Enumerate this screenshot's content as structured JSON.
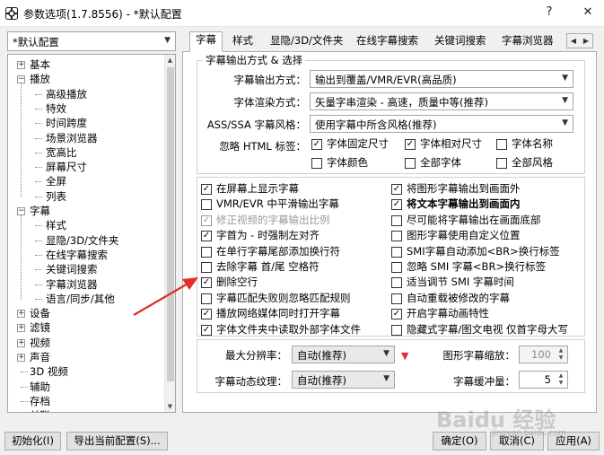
{
  "window": {
    "title": "参数选项(1.7.8556) - *默认配置",
    "buttons": [
      "?",
      "✕"
    ]
  },
  "profile": {
    "value": "*默认配置"
  },
  "tree": [
    {
      "label": "基本",
      "expander": "+",
      "level": 0
    },
    {
      "label": "播放",
      "expander": "−",
      "level": 0
    },
    {
      "label": "高级播放",
      "level": 1
    },
    {
      "label": "特效",
      "level": 1
    },
    {
      "label": "时间跨度",
      "level": 1
    },
    {
      "label": "场景浏览器",
      "level": 1
    },
    {
      "label": "宽高比",
      "level": 1
    },
    {
      "label": "屏幕尺寸",
      "level": 1
    },
    {
      "label": "全屏",
      "level": 1
    },
    {
      "label": "列表",
      "level": 1
    },
    {
      "label": "字幕",
      "expander": "−",
      "level": 0
    },
    {
      "label": "样式",
      "level": 1
    },
    {
      "label": "显隐/3D/文件夹",
      "level": 1
    },
    {
      "label": "在线字幕搜索",
      "level": 1
    },
    {
      "label": "关键词搜索",
      "level": 1
    },
    {
      "label": "字幕浏览器",
      "level": 1
    },
    {
      "label": "语言/同步/其他",
      "level": 1
    },
    {
      "label": "设备",
      "expander": "+",
      "level": 0
    },
    {
      "label": "滤镜",
      "expander": "+",
      "level": 0
    },
    {
      "label": "视频",
      "expander": "+",
      "level": 0
    },
    {
      "label": "声音",
      "expander": "+",
      "level": 0
    },
    {
      "label": "3D 视频",
      "level": 0
    },
    {
      "label": "辅助",
      "level": 0
    },
    {
      "label": "存档",
      "level": 0
    },
    {
      "label": "关联",
      "level": 0
    }
  ],
  "tabs": [
    "字幕",
    "样式",
    "显隐/3D/文件夹",
    "在线字幕搜索",
    "关键词搜索",
    "字幕浏览器"
  ],
  "tab_arrows": [
    "◀",
    "▶"
  ],
  "output_group": {
    "title": "字幕输出方式 & 选择",
    "rows": [
      {
        "label": "字幕输出方式：",
        "value": "输出到覆盖/VMR/EVR(高品质)"
      },
      {
        "label": "字体渲染方式：",
        "value": "矢量字串渲染 - 高速，质量中等(推荐)"
      },
      {
        "label": "ASS/SSA 字幕风格：",
        "value": "使用字幕中所含风格(推荐)"
      }
    ],
    "ignore_label": "忽略 HTML 标签：",
    "ignore_options": [
      {
        "label": "字体固定尺寸",
        "checked": true
      },
      {
        "label": "字体相对尺寸",
        "checked": true
      },
      {
        "label": "字体名称",
        "checked": false
      },
      {
        "label": "字体颜色",
        "checked": false
      },
      {
        "label": "全部字体",
        "checked": false
      },
      {
        "label": "全部风格",
        "checked": false
      }
    ]
  },
  "options_left": [
    {
      "label": "在屏幕上显示字幕",
      "checked": true
    },
    {
      "label": "VMR/EVR 中平滑输出字幕",
      "checked": false
    },
    {
      "label": "修正视频的字幕输出比例",
      "checked": true,
      "disabled": true
    },
    {
      "label": "字首为 - 时强制左对齐",
      "checked": true
    },
    {
      "label": "在单行字幕尾部添加换行符",
      "checked": false
    },
    {
      "label": "去除字幕 首/尾 空格符",
      "checked": false
    },
    {
      "label": "删除空行",
      "checked": true
    },
    {
      "label": "字幕匹配失败则忽略匹配规则",
      "checked": false
    },
    {
      "label": "播放网络媒体同时打开字幕",
      "checked": true
    },
    {
      "label": "字体文件夹中读取外部字体文件",
      "checked": true
    }
  ],
  "options_right": [
    {
      "label": "将图形字幕输出到画面外",
      "checked": true
    },
    {
      "label": "将文本字幕输出到画面内",
      "checked": true,
      "bold": true
    },
    {
      "label": "尽可能将字幕输出在画面底部",
      "checked": false
    },
    {
      "label": "图形字幕使用自定义位置",
      "checked": false
    },
    {
      "label": "SMI字幕自动添加<BR>换行标签",
      "checked": false
    },
    {
      "label": "忽略 SMI 字幕<BR>换行标签",
      "checked": false
    },
    {
      "label": "适当调节 SMI 字幕时间",
      "checked": false
    },
    {
      "label": "自动重载被修改的字幕",
      "checked": false
    },
    {
      "label": "开启字幕动画特性",
      "checked": true
    },
    {
      "label": "隐藏式字幕/图文电视 仅首字母大写",
      "checked": false
    }
  ],
  "bottom_settings": {
    "max_res_label": "最大分辨率：",
    "max_res_value": "自动(推荐)",
    "dyn_texture_label": "字幕动态纹理：",
    "dyn_texture_value": "自动(推荐)",
    "img_zoom_label": "图形字幕缩放：",
    "img_zoom_value": "100",
    "buffer_label": "字幕缓冲量：",
    "buffer_value": "5"
  },
  "footer": {
    "init": "初始化(I)",
    "export": "导出当前配置(S)...",
    "ok": "确定(O)",
    "cancel": "取消(C)",
    "apply": "应用(A)"
  },
  "watermark": {
    "brand": "Baidu 经验",
    "sub": "jingyan.baidu.com"
  },
  "colors": {
    "annotation_red": "#e0302b",
    "panel": "#ffffff",
    "window": "#f0f0f0"
  }
}
